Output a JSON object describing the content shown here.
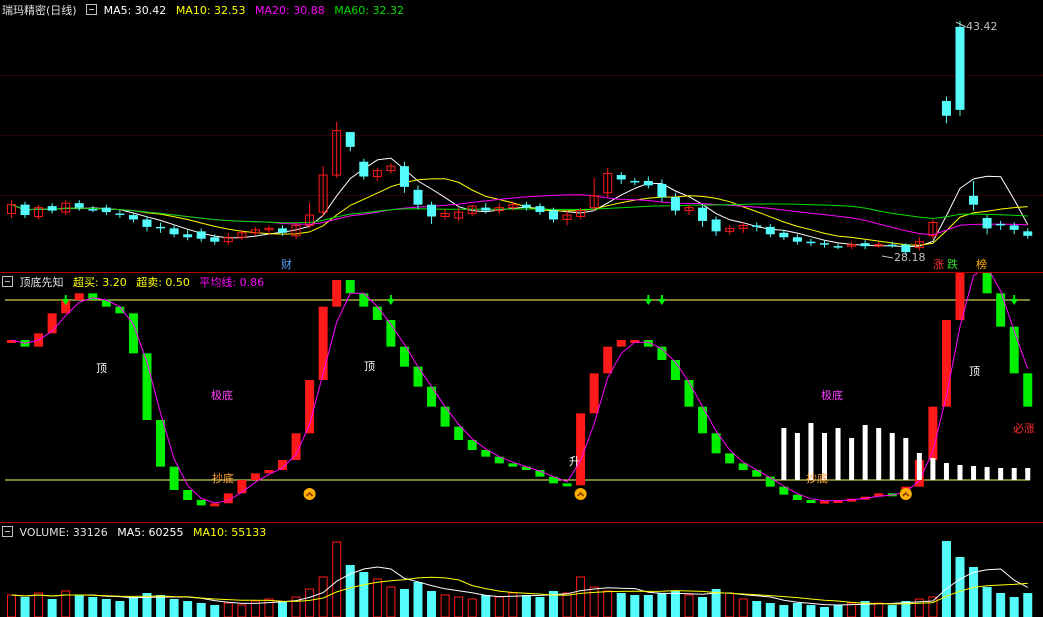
{
  "colors": {
    "up": "#ff1a1a",
    "down": "#54fcfc",
    "ma5": "#ffffff",
    "ma10": "#ffff00",
    "ma20": "#ff00ff",
    "ma60": "#00e000",
    "ref": "#ffff66",
    "bg": "#000000",
    "grid": "#5a0000",
    "tick": "#3a6ad0"
  },
  "main": {
    "stock_name": "瑞玛精密(日线)",
    "ma5": "MA5: 30.42",
    "ma10": "MA10: 32.53",
    "ma20": "MA20: 30.88",
    "ma60": "MA60: 32.32",
    "high_label": "43.42",
    "low_label": "28.18",
    "marker_cai": "财",
    "marker_zhang": "涨",
    "marker_die": "跌",
    "marker_bang": "榜"
  },
  "indicator": {
    "name": "顶底先知",
    "overbuy": "超买: 3.20",
    "oversell": "超卖: 0.50",
    "avg_line": "平均线: 0.86",
    "label_ding_1": "顶",
    "label_ding_2": "顶",
    "label_ding_3": "顶",
    "label_jidi_1": "极底",
    "label_jidi_2": "极底",
    "label_chaodi_1": "抄底",
    "label_chaodi_2": "抄底",
    "label_sheng": "升",
    "label_bizhang": "必涨"
  },
  "volume": {
    "title": "VOLUME: 33126",
    "ma5": "MA5: 60255",
    "ma10": "MA10: 55133"
  },
  "chart_data": {
    "type": "candlestick",
    "candles": [
      [
        30.4,
        31.0,
        30.1,
        31.3
      ],
      [
        31.0,
        30.3,
        30.1,
        31.2
      ],
      [
        30.2,
        30.8,
        30.0,
        31.0
      ],
      [
        30.9,
        30.6,
        30.4,
        31.1
      ],
      [
        30.5,
        31.1,
        30.3,
        31.3
      ],
      [
        31.1,
        30.8,
        30.6,
        31.3
      ],
      [
        30.7,
        30.6,
        30.5,
        30.9
      ],
      [
        30.8,
        30.5,
        30.3,
        31.0
      ],
      [
        30.4,
        30.3,
        30.1,
        30.6
      ],
      [
        30.3,
        30.0,
        29.8,
        30.4
      ],
      [
        30.0,
        29.5,
        29.2,
        30.2
      ],
      [
        29.5,
        29.4,
        29.1,
        29.8
      ],
      [
        29.4,
        29.0,
        28.8,
        29.6
      ],
      [
        29.0,
        28.8,
        28.6,
        29.3
      ],
      [
        29.2,
        28.7,
        28.5,
        29.4
      ],
      [
        28.8,
        28.5,
        28.3,
        29.0
      ],
      [
        28.5,
        28.8,
        28.3,
        29.1
      ],
      [
        28.8,
        29.1,
        28.6,
        29.3
      ],
      [
        29.1,
        29.3,
        28.9,
        29.5
      ],
      [
        29.3,
        29.4,
        29.0,
        29.6
      ],
      [
        29.4,
        29.1,
        28.9,
        29.6
      ],
      [
        28.9,
        29.6,
        28.7,
        29.8
      ],
      [
        29.6,
        30.3,
        29.4,
        31.1
      ],
      [
        30.5,
        33.0,
        30.2,
        33.6
      ],
      [
        33.0,
        36.0,
        32.8,
        36.6
      ],
      [
        35.9,
        34.9,
        34.6,
        35.8
      ],
      [
        33.9,
        32.9,
        32.7,
        34.1
      ],
      [
        32.9,
        33.3,
        32.6,
        33.5
      ],
      [
        33.3,
        33.6,
        33.1,
        33.8
      ],
      [
        33.6,
        32.2,
        31.8,
        33.9
      ],
      [
        32.0,
        31.0,
        30.7,
        32.3
      ],
      [
        31.0,
        30.2,
        29.7,
        31.2
      ],
      [
        30.2,
        30.4,
        30.0,
        30.7
      ],
      [
        30.1,
        30.5,
        29.9,
        30.8
      ],
      [
        30.4,
        30.9,
        30.2,
        31.0
      ],
      [
        30.8,
        30.6,
        30.4,
        31.1
      ],
      [
        30.6,
        30.8,
        30.4,
        31.1
      ],
      [
        30.8,
        31.0,
        30.6,
        31.2
      ],
      [
        31.0,
        30.8,
        30.6,
        31.2
      ],
      [
        30.9,
        30.5,
        30.3,
        31.1
      ],
      [
        30.6,
        30.0,
        29.8,
        30.8
      ],
      [
        30.0,
        30.3,
        29.6,
        30.6
      ],
      [
        30.2,
        30.6,
        30.0,
        30.8
      ],
      [
        30.8,
        31.6,
        30.6,
        32.8
      ],
      [
        31.8,
        33.1,
        31.5,
        33.5
      ],
      [
        33.0,
        32.7,
        32.4,
        33.2
      ],
      [
        32.6,
        32.5,
        32.3,
        32.8
      ],
      [
        32.6,
        32.3,
        32.1,
        32.9
      ],
      [
        32.4,
        31.5,
        31.2,
        32.7
      ],
      [
        31.5,
        30.6,
        30.3,
        31.8
      ],
      [
        30.6,
        30.8,
        30.3,
        31.0
      ],
      [
        30.8,
        29.9,
        29.5,
        31.0
      ],
      [
        30.0,
        29.2,
        28.9,
        30.2
      ],
      [
        29.2,
        29.4,
        29.0,
        29.6
      ],
      [
        29.4,
        29.6,
        29.1,
        29.8
      ],
      [
        29.6,
        29.5,
        29.2,
        29.8
      ],
      [
        29.5,
        29.0,
        28.8,
        29.7
      ],
      [
        29.1,
        28.8,
        28.6,
        29.3
      ],
      [
        28.8,
        28.5,
        28.3,
        29.0
      ],
      [
        28.5,
        28.4,
        28.2,
        28.7
      ],
      [
        28.4,
        28.3,
        28.1,
        28.6
      ],
      [
        28.2,
        28.1,
        28.0,
        28.4
      ],
      [
        28.2,
        28.3,
        28.0,
        28.5
      ],
      [
        28.4,
        28.2,
        28.0,
        28.6
      ],
      [
        28.2,
        28.3,
        28.1,
        28.5
      ],
      [
        28.3,
        28.2,
        28.1,
        28.5
      ],
      [
        28.3,
        27.8,
        27.6,
        28.4
      ],
      [
        28.1,
        28.5,
        27.9,
        28.8
      ],
      [
        28.9,
        29.8,
        28.7,
        30.0
      ],
      [
        38.0,
        37.0,
        36.5,
        38.3
      ],
      [
        43.0,
        37.4,
        37.0,
        43.4
      ],
      [
        31.6,
        31.0,
        30.6,
        32.6
      ],
      [
        30.1,
        29.4,
        29.0,
        30.3
      ],
      [
        29.7,
        29.6,
        29.3,
        29.9
      ],
      [
        29.6,
        29.3,
        29.0,
        29.8
      ],
      [
        29.2,
        28.9,
        28.7,
        29.4
      ]
    ]
  }
}
